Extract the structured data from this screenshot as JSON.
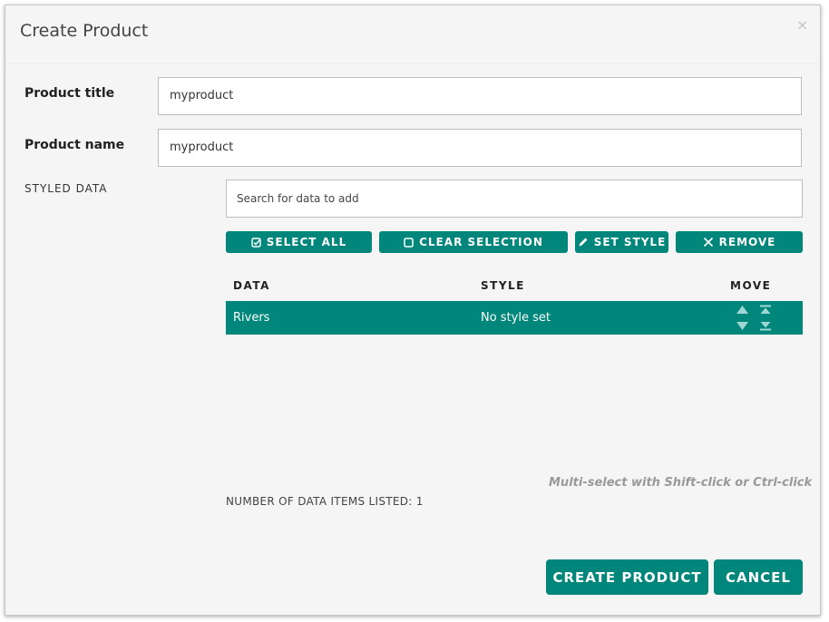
{
  "dialog": {
    "title": "Create Product",
    "close_glyph": "×"
  },
  "fields": {
    "title_label": "Product title",
    "title_value": "myproduct",
    "name_label": "Product name",
    "name_value": "myproduct"
  },
  "styled_data": {
    "section_label": "STYLED DATA",
    "search_placeholder": "Search for data to add",
    "buttons": {
      "select_all": "SELECT ALL",
      "clear_selection": "CLEAR SELECTION",
      "set_style": "SET STYLE",
      "remove": "REMOVE"
    },
    "columns": {
      "data": "DATA",
      "style": "STYLE",
      "move": "MOVE"
    },
    "rows": [
      {
        "data": "Rivers",
        "style": "No style set",
        "selected": true
      }
    ],
    "hint": "Multi-select with Shift-click or Ctrl-click",
    "count_text": "NUMBER OF DATA ITEMS LISTED: 1"
  },
  "footer": {
    "create_label": "CREATE PRODUCT",
    "cancel_label": "CANCEL"
  },
  "colors": {
    "accent": "#00867a",
    "background": "#f5f5f5",
    "hint_text": "#999999"
  },
  "icons": {
    "select_all": "checkbox-checked-icon",
    "clear_selection": "checkbox-empty-icon",
    "set_style": "pencil-icon",
    "remove": "x-icon",
    "move_up": "arrow-up-icon",
    "move_down": "arrow-down-icon",
    "move_top": "move-to-top-icon",
    "move_bottom": "move-to-bottom-icon"
  }
}
